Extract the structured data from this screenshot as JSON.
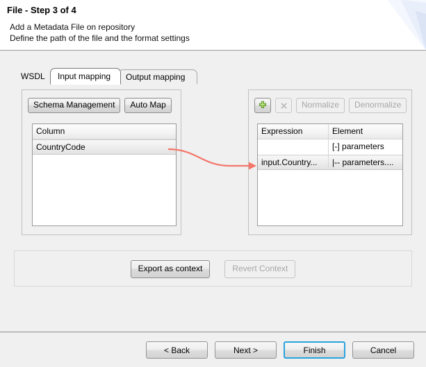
{
  "header": {
    "title": "File - Step 3 of 4",
    "subtitle_line1": "Add a Metadata File on repository",
    "subtitle_line2": "Define the path of the file and the format settings"
  },
  "tabs": [
    {
      "label": "WSDL",
      "active": false
    },
    {
      "label": "Input mapping",
      "active": true
    },
    {
      "label": "Output mapping",
      "active": false
    }
  ],
  "left_panel": {
    "schema_management_label": "Schema Management",
    "auto_map_label": "Auto Map",
    "table": {
      "columns": [
        "Column"
      ],
      "rows": [
        {
          "column": "CountryCode",
          "selected": true
        }
      ]
    }
  },
  "right_panel": {
    "add_icon": "plus-icon",
    "delete_icon": "close-x-icon",
    "normalize_label": "Normalize",
    "denormalize_label": "Denormalize",
    "table": {
      "columns": [
        "Expression",
        "Element"
      ],
      "rows": [
        {
          "expression": "",
          "element": "[-] parameters",
          "selected": false
        },
        {
          "expression": "input.Country...",
          "element": "|-- parameters....",
          "selected": true
        }
      ]
    }
  },
  "context_box": {
    "export_label": "Export as context",
    "revert_label": "Revert Context"
  },
  "footer": {
    "back_label": "< Back",
    "next_label": "Next >",
    "finish_label": "Finish",
    "cancel_label": "Cancel"
  },
  "colors": {
    "connector": "#f4766a",
    "focus_border": "#2aa3dd",
    "body_background": "#f0f0f0",
    "panel_background": "#ffffff",
    "add_icon_green": "#7cc04a"
  }
}
